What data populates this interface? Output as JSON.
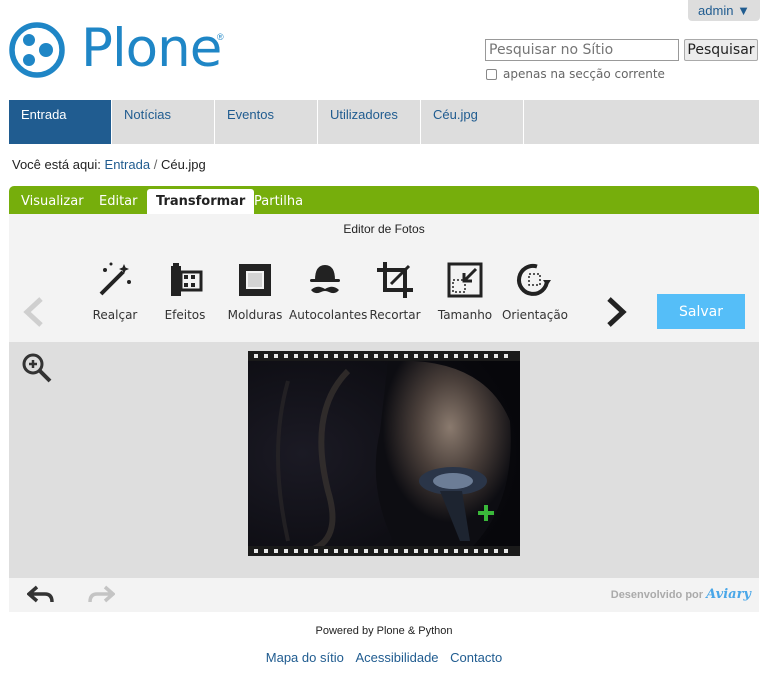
{
  "user_menu": {
    "label": "admin ▼"
  },
  "logo": {
    "text": "Plone",
    "reg": "®"
  },
  "search": {
    "placeholder": "Pesquisar no Sítio",
    "value": "",
    "button_label": "Pesquisar",
    "scope_label": "apenas na secção corrente",
    "scope_checked": false
  },
  "globalnav": [
    {
      "label": "Entrada",
      "selected": true
    },
    {
      "label": "Notícias",
      "selected": false
    },
    {
      "label": "Eventos",
      "selected": false
    },
    {
      "label": "Utilizadores",
      "selected": false
    },
    {
      "label": "Céu.jpg",
      "selected": false
    }
  ],
  "breadcrumb": {
    "prefix": "Você está aqui:",
    "home": "Entrada",
    "separator": "/",
    "current": "Céu.jpg"
  },
  "content_views": [
    {
      "label": "Visualizar",
      "active": false
    },
    {
      "label": "Editar",
      "active": false
    },
    {
      "label": "Transformar",
      "active": true
    },
    {
      "label": "Partilha",
      "active": false
    }
  ],
  "editor": {
    "title": "Editor de Fotos",
    "tools": [
      {
        "label": "Realçar",
        "icon": "magic-wand-icon"
      },
      {
        "label": "Efeitos",
        "icon": "film-icon"
      },
      {
        "label": "Molduras",
        "icon": "frame-icon"
      },
      {
        "label": "Autocolantes",
        "icon": "hat-mustache-icon"
      },
      {
        "label": "Recortar",
        "icon": "crop-icon"
      },
      {
        "label": "Tamanho",
        "icon": "resize-icon"
      },
      {
        "label": "Orientação",
        "icon": "rotate-icon"
      }
    ],
    "save_label": "Salvar",
    "powered_by": "Desenvolvido por",
    "powered_brand": "Aviary"
  },
  "footer": {
    "powered": "Powered by Plone & Python",
    "links": [
      "Mapa do sítio",
      "Acessibilidade",
      "Contacto"
    ]
  },
  "colors": {
    "plone_blue": "#1f86c6",
    "nav_blue": "#205c90",
    "green": "#76ae0c",
    "save": "#55bef8"
  }
}
